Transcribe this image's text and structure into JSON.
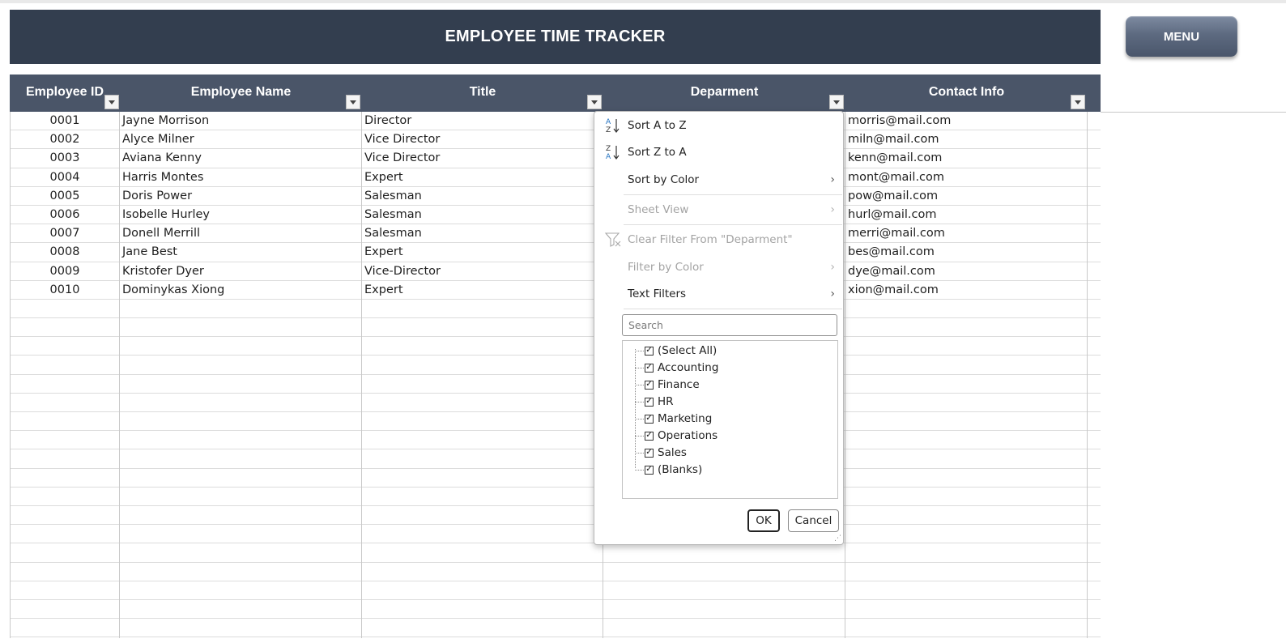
{
  "header": {
    "title": "EMPLOYEE TIME TRACKER",
    "menu_label": "MENU"
  },
  "table": {
    "columns": [
      "Employee ID",
      "Employee Name",
      "Title",
      "Deparment",
      "Contact Info"
    ],
    "rows": [
      [
        "0001",
        "Jayne Morrison",
        "Director",
        "",
        "morris@mail.com"
      ],
      [
        "0002",
        "Alyce Milner",
        "Vice Director",
        "",
        "miln@mail.com"
      ],
      [
        "0003",
        "Aviana Kenny",
        "Vice Director",
        "",
        "kenn@mail.com"
      ],
      [
        "0004",
        "Harris Montes",
        "Expert",
        "",
        "mont@mail.com"
      ],
      [
        "0005",
        "Doris Power",
        "Salesman",
        "",
        "pow@mail.com"
      ],
      [
        "0006",
        "Isobelle Hurley",
        "Salesman",
        "",
        "hurl@mail.com"
      ],
      [
        "0007",
        "Donell Merrill",
        "Salesman",
        "",
        "merri@mail.com"
      ],
      [
        "0008",
        "Jane Best",
        "Expert",
        "",
        "bes@mail.com"
      ],
      [
        "0009",
        "Kristofer Dyer",
        "Vice-Director",
        "",
        "dye@mail.com"
      ],
      [
        "0010",
        "Dominykas Xiong",
        "Expert",
        "",
        "xion@mail.com"
      ]
    ]
  },
  "filter_menu": {
    "sort_az": "Sort A to Z",
    "sort_za": "Sort Z to A",
    "sort_by_color": "Sort by Color",
    "sheet_view": "Sheet View",
    "clear_filter": "Clear Filter From \"Deparment\"",
    "filter_by_color": "Filter by Color",
    "text_filters": "Text Filters",
    "search_placeholder": "Search",
    "items": [
      "(Select All)",
      "Accounting",
      "Finance",
      "HR",
      "Marketing",
      "Operations",
      "Sales",
      "(Blanks)"
    ],
    "ok_label": "OK",
    "cancel_label": "Cancel"
  },
  "colors": {
    "title_bar": "#333e4f",
    "header_row": "#4a5568",
    "menu_button": "#5d6a80"
  }
}
